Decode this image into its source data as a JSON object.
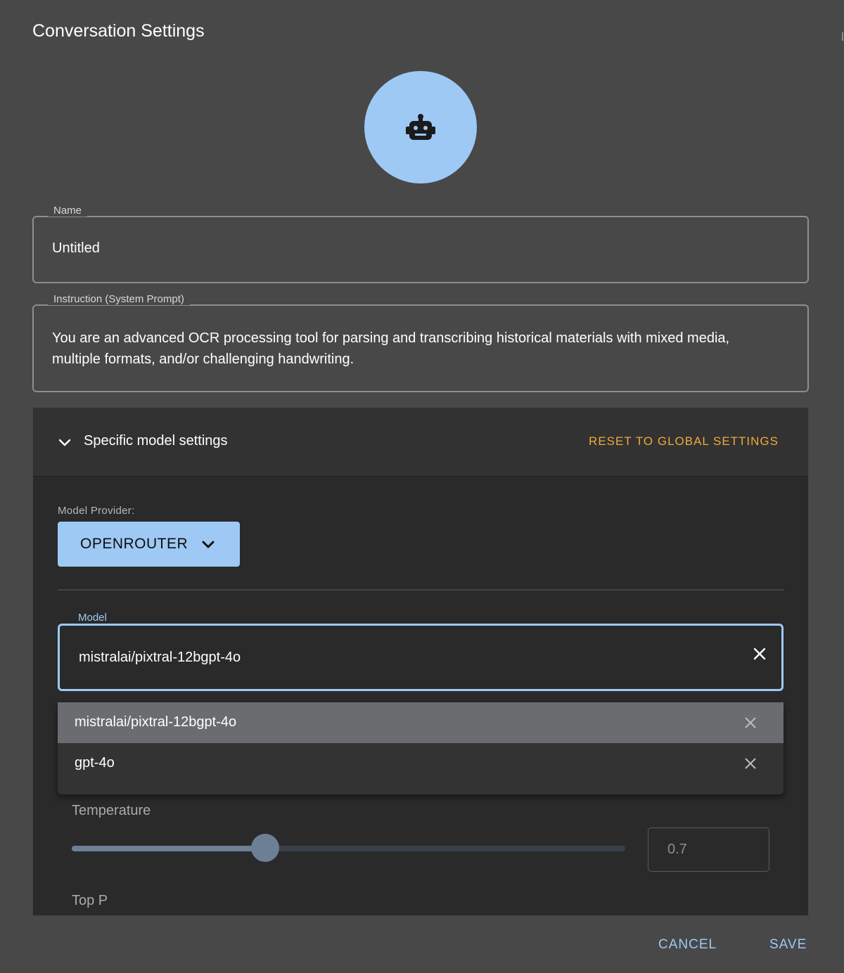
{
  "dialog": {
    "title": "Conversation Settings"
  },
  "avatar": {
    "icon": "robot-icon",
    "background": "#9ec9f5"
  },
  "name": {
    "label": "Name",
    "value": "Untitled"
  },
  "instruction": {
    "label": "Instruction (System Prompt)",
    "value": "You are an advanced OCR processing tool for parsing and transcribing historical materials with mixed media, multiple formats, and/or challenging handwriting."
  },
  "model_settings": {
    "title": "Specific model settings",
    "expanded": true,
    "reset_label": "RESET TO GLOBAL SETTINGS",
    "provider": {
      "label": "Model Provider:",
      "value": "OPENROUTER"
    },
    "model": {
      "label": "Model",
      "value": "mistralai/pixtral-12bgpt-4o",
      "options": [
        {
          "label": "mistralai/pixtral-12bgpt-4o",
          "selected": true
        },
        {
          "label": "gpt-4o",
          "selected": false
        }
      ]
    },
    "temperature": {
      "label": "Temperature",
      "value": "0.7",
      "fraction": 0.35
    },
    "top_p": {
      "label": "Top P"
    }
  },
  "actions": {
    "cancel": "CANCEL",
    "save": "SAVE"
  },
  "colors": {
    "accent": "#9ec9f5",
    "reset": "#f0a93a",
    "background": "#484848"
  }
}
